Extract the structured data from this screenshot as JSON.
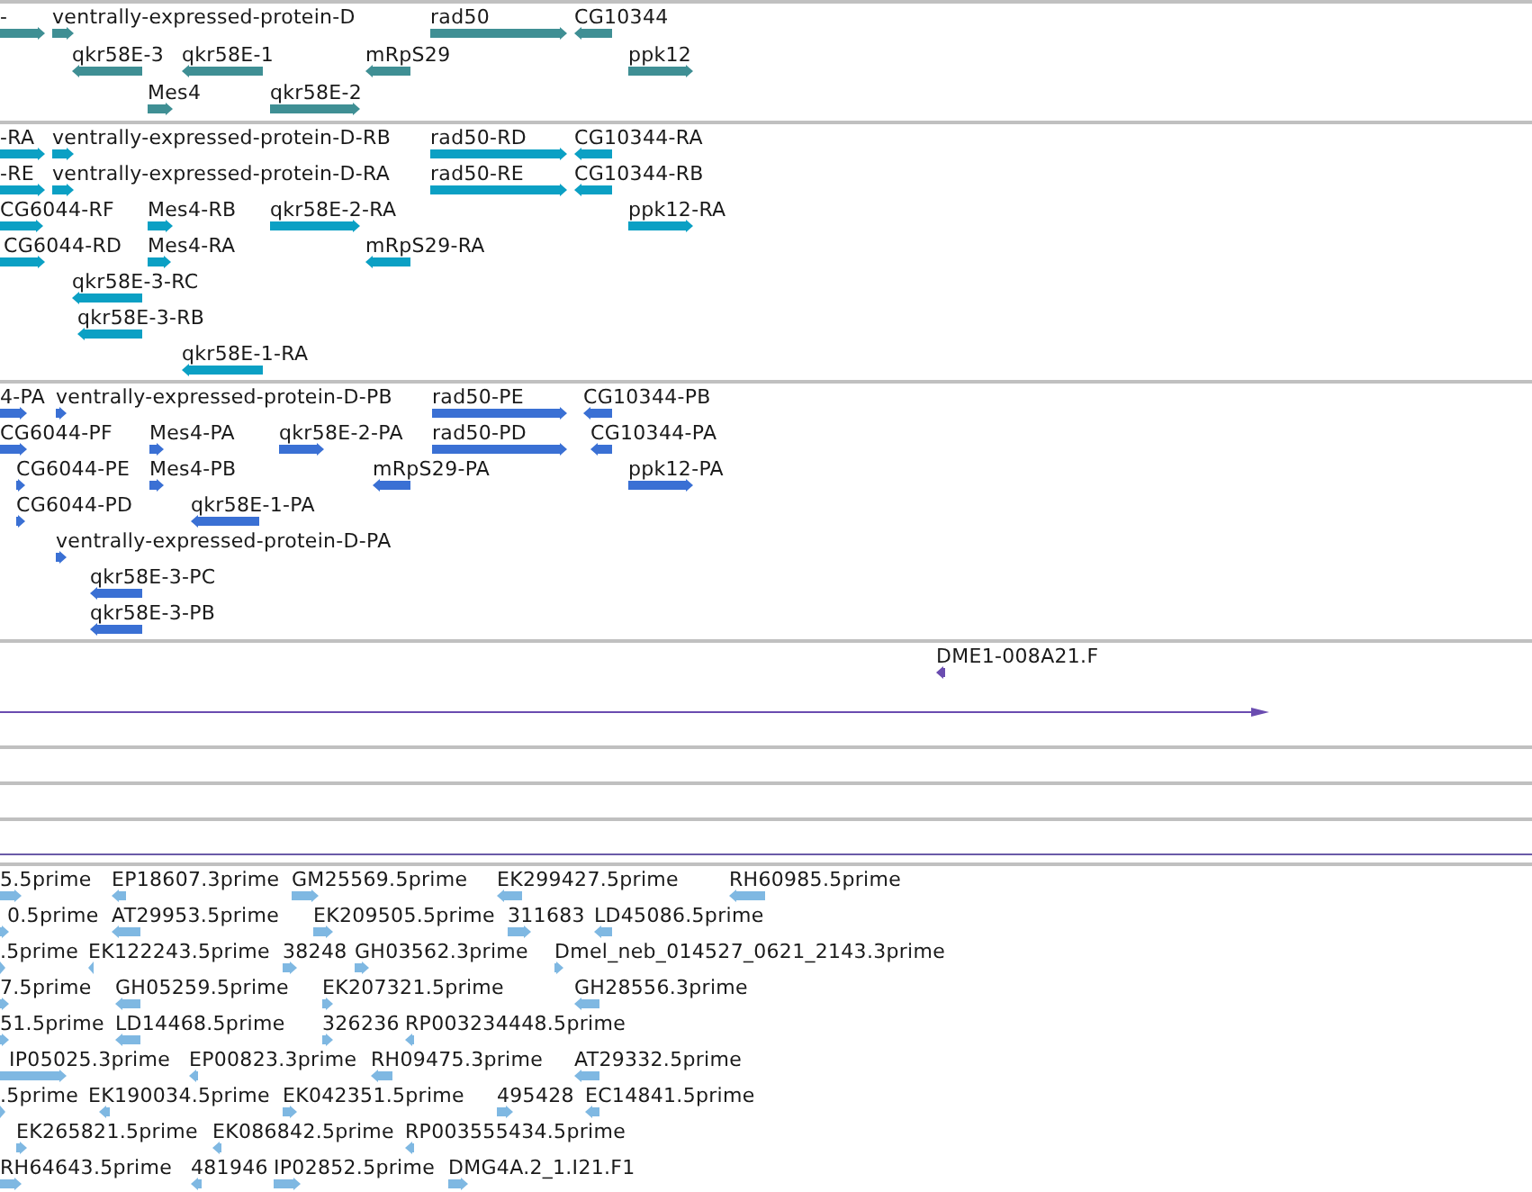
{
  "tracks": [
    {
      "kind": "gene",
      "color": "#3f8f94",
      "rows": [
        {
          "features": [
            {
              "label": "-",
              "reverse": false
            },
            {
              "label": "ventrally-expressed-protein-D",
              "reverse": false
            },
            {
              "label": "rad50",
              "reverse": false
            },
            {
              "label": "CG10344",
              "reverse": true
            }
          ]
        },
        {
          "features": [
            {
              "label": "qkr58E-3",
              "reverse": true
            },
            {
              "label": "qkr58E-1",
              "reverse": true
            },
            {
              "label": "mRpS29",
              "reverse": true
            },
            {
              "label": "ppk12",
              "reverse": false
            }
          ]
        },
        {
          "features": [
            {
              "label": "Mes4",
              "reverse": false
            },
            {
              "label": "qkr58E-2",
              "reverse": false
            }
          ]
        }
      ]
    },
    {
      "kind": "transcript",
      "color": "#0ba0c4",
      "rows": [
        {
          "features": [
            {
              "label": "-RA",
              "reverse": false
            },
            {
              "label": "ventrally-expressed-protein-D-RB",
              "reverse": false
            },
            {
              "label": "rad50-RD",
              "reverse": false
            },
            {
              "label": "CG10344-RA",
              "reverse": true
            }
          ]
        },
        {
          "features": [
            {
              "label": "-RE",
              "reverse": false
            },
            {
              "label": "ventrally-expressed-protein-D-RA",
              "reverse": false
            },
            {
              "label": "rad50-RE",
              "reverse": false
            },
            {
              "label": "CG10344-RB",
              "reverse": true
            }
          ]
        },
        {
          "features": [
            {
              "label": "CG6044-RF",
              "reverse": false
            },
            {
              "label": "Mes4-RB",
              "reverse": false
            },
            {
              "label": "qkr58E-2-RA",
              "reverse": false
            },
            {
              "label": "ppk12-RA",
              "reverse": false
            }
          ]
        },
        {
          "features": [
            {
              "label": "CG6044-RD",
              "reverse": false
            },
            {
              "label": "Mes4-RA",
              "reverse": false
            },
            {
              "label": "mRpS29-RA",
              "reverse": true
            }
          ]
        },
        {
          "features": [
            {
              "label": "qkr58E-3-RC",
              "reverse": true
            }
          ]
        },
        {
          "features": [
            {
              "label": "qkr58E-3-RB",
              "reverse": true
            }
          ]
        },
        {
          "features": [
            {
              "label": "qkr58E-1-RA",
              "reverse": true
            }
          ]
        }
      ]
    },
    {
      "kind": "protein",
      "color": "#3a70d4",
      "rows": [
        {
          "features": [
            {
              "label": "4-PA",
              "reverse": false
            },
            {
              "label": "ventrally-expressed-protein-D-PB",
              "reverse": false
            },
            {
              "label": "rad50-PE",
              "reverse": false
            },
            {
              "label": "CG10344-PB",
              "reverse": true
            }
          ]
        },
        {
          "features": [
            {
              "label": "CG6044-PF",
              "reverse": false
            },
            {
              "label": "Mes4-PA",
              "reverse": false
            },
            {
              "label": "qkr58E-2-PA",
              "reverse": false
            },
            {
              "label": "rad50-PD",
              "reverse": false
            },
            {
              "label": "CG10344-PA",
              "reverse": true
            }
          ]
        },
        {
          "features": [
            {
              "label": "CG6044-PE",
              "reverse": false
            },
            {
              "label": "Mes4-PB",
              "reverse": false
            },
            {
              "label": "mRpS29-PA",
              "reverse": true
            },
            {
              "label": "ppk12-PA",
              "reverse": false
            }
          ]
        },
        {
          "features": [
            {
              "label": "CG6044-PD",
              "reverse": false
            },
            {
              "label": "qkr58E-1-PA",
              "reverse": true
            }
          ]
        },
        {
          "features": [
            {
              "label": "ventrally-expressed-protein-D-PA",
              "reverse": false
            }
          ]
        },
        {
          "features": [
            {
              "label": "qkr58E-3-PC",
              "reverse": true
            }
          ]
        },
        {
          "features": [
            {
              "label": "qkr58E-3-PB",
              "reverse": true
            }
          ]
        }
      ]
    },
    {
      "kind": "clone",
      "color": "#6a4cb0",
      "rows": [
        {
          "features": [
            {
              "label": "DME1-008A21.F",
              "reverse": true
            }
          ]
        }
      ],
      "alignment": {
        "reverse": false
      }
    },
    {
      "kind": "empty"
    },
    {
      "kind": "empty"
    },
    {
      "kind": "empty"
    },
    {
      "kind": "est",
      "color": "#7fb8e2",
      "rows": [
        {
          "features": [
            {
              "label": "5.5prime",
              "reverse": false
            },
            {
              "label": "EP18607.3prime",
              "reverse": true
            },
            {
              "label": "GM25569.5prime",
              "reverse": false
            },
            {
              "label": "EK299427.5prime",
              "reverse": true
            },
            {
              "label": "RH60985.5prime",
              "reverse": true
            }
          ]
        },
        {
          "features": [
            {
              "label": "0.5prime",
              "reverse": false
            },
            {
              "label": "AT29953.5prime",
              "reverse": true
            },
            {
              "label": "EK209505.5prime",
              "reverse": false
            },
            {
              "label": "311683",
              "reverse": false
            },
            {
              "label": "LD45086.5prime",
              "reverse": true
            }
          ]
        },
        {
          "features": [
            {
              "label": ".5prime",
              "reverse": false
            },
            {
              "label": "EK122243.5prime",
              "reverse": true
            },
            {
              "label": "38248",
              "reverse": false
            },
            {
              "label": "GH03562.3prime",
              "reverse": false
            },
            {
              "label": "Dmel_neb_014527_0621_2143.3prime",
              "reverse": false
            }
          ]
        },
        {
          "features": [
            {
              "label": "7.5prime",
              "reverse": false
            },
            {
              "label": "GH05259.5prime",
              "reverse": true
            },
            {
              "label": "EK207321.5prime",
              "reverse": false
            },
            {
              "label": "GH28556.3prime",
              "reverse": true
            }
          ]
        },
        {
          "features": [
            {
              "label": "51.5prime",
              "reverse": false
            },
            {
              "label": "LD14468.5prime",
              "reverse": true
            },
            {
              "label": "326236",
              "reverse": false
            },
            {
              "label": "RP003234448.5prime",
              "reverse": true
            }
          ]
        },
        {
          "features": [
            {
              "label": "IP05025.3prime",
              "reverse": false
            },
            {
              "label": "EP00823.3prime",
              "reverse": true
            },
            {
              "label": "RH09475.3prime",
              "reverse": true
            },
            {
              "label": "AT29332.5prime",
              "reverse": true
            }
          ]
        },
        {
          "features": [
            {
              "label": ".5prime",
              "reverse": false
            },
            {
              "label": "EK190034.5prime",
              "reverse": true
            },
            {
              "label": "EK042351.5prime",
              "reverse": false
            },
            {
              "label": "495428",
              "reverse": false
            },
            {
              "label": "EC14841.5prime",
              "reverse": true
            }
          ]
        },
        {
          "features": [
            {
              "label": "EK265821.5prime",
              "reverse": false
            },
            {
              "label": "EK086842.5prime",
              "reverse": true
            },
            {
              "label": "RP003555434.5prime",
              "reverse": true
            }
          ]
        },
        {
          "features": [
            {
              "label": "RH64643.5prime",
              "reverse": false
            },
            {
              "label": "481946",
              "reverse": true
            },
            {
              "label": "IP02852.5prime",
              "reverse": false
            },
            {
              "label": "DMG4A.2_1.I21.F1",
              "reverse": false
            }
          ]
        }
      ]
    }
  ]
}
